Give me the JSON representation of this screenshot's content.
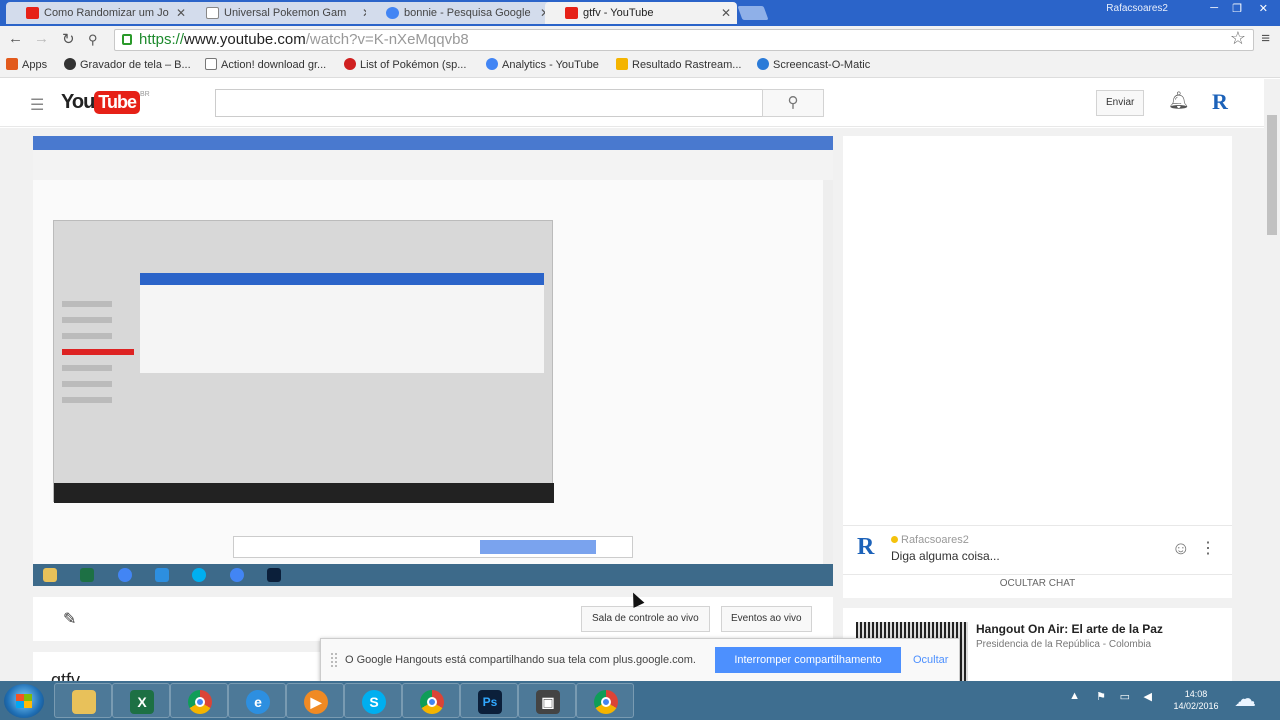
{
  "browser": {
    "tabs": [
      {
        "label": "Como Randomizar um Jo",
        "icon": "youtube-icon",
        "color": "#e62117"
      },
      {
        "label": "Universal Pokemon Gam",
        "icon": "page-icon",
        "color": "#ffffff"
      },
      {
        "label": "bonnie - Pesquisa Google",
        "icon": "google-icon",
        "color": "#4285f4"
      },
      {
        "label": "gtfv - YouTube",
        "icon": "youtube-icon",
        "color": "#e62117"
      }
    ],
    "window_user": "Rafacsoares2",
    "url": {
      "scheme": "https://",
      "host": "www.youtube.com",
      "path": "/watch?v=K-nXeMqqvb8"
    },
    "bookmarks": [
      {
        "label": "Apps",
        "icon": "apps-icon",
        "color": "#e25a1c"
      },
      {
        "label": "Gravador de tela – B...",
        "icon": "recorder-icon",
        "color": "#333333"
      },
      {
        "label": "Action! download gr...",
        "icon": "page-icon",
        "color": "#ffffff"
      },
      {
        "label": "List of Pokémon (sp...",
        "icon": "pokeball-icon",
        "color": "#d02020"
      },
      {
        "label": "Analytics - YouTube",
        "icon": "google-icon",
        "color": "#4285f4"
      },
      {
        "label": "Resultado Rastream...",
        "icon": "tracking-icon",
        "color": "#f4b400"
      },
      {
        "label": "Screencast-O-Matic",
        "icon": "screencast-icon",
        "color": "#2b7bd8"
      }
    ]
  },
  "youtube": {
    "logo_you": "You",
    "logo_tube": "Tube",
    "logo_region": "BR",
    "search_placeholder": "",
    "upload_label": "Enviar",
    "avatar_letter": "R",
    "video_title": "gtfv"
  },
  "chat": {
    "avatar_letter": "R",
    "username": "Rafacsoares2",
    "input_prompt": "Diga alguma coisa...",
    "hide_chat_label": "OCULTAR CHAT"
  },
  "controls": {
    "control_room_label": "Sala de controle ao vivo",
    "live_events_label": "Eventos ao vivo"
  },
  "related": {
    "title": "Hangout On Air: El arte de la Paz",
    "channel": "Presidencia de la República - Colombia"
  },
  "share_notice": {
    "message": "O Google Hangouts está compartilhando sua tela com plus.google.com.",
    "stop_label": "Interromper compartilhamento",
    "hide_label": "Ocultar"
  },
  "taskbar": {
    "apps": [
      {
        "name": "file-explorer",
        "label": "",
        "color": "#e8c15a"
      },
      {
        "name": "excel",
        "label": "X",
        "color": "#1d7044"
      },
      {
        "name": "chrome",
        "label": "",
        "color": "#4285f4"
      },
      {
        "name": "internet-explorer",
        "label": "e",
        "color": "#2d8fe0"
      },
      {
        "name": "media-player",
        "label": "▶",
        "color": "#f08a24"
      },
      {
        "name": "skype",
        "label": "S",
        "color": "#00aff0"
      },
      {
        "name": "chrome-2",
        "label": "",
        "color": "#4285f4"
      },
      {
        "name": "photoshop",
        "label": "Ps",
        "color": "#0b1f3a"
      },
      {
        "name": "recorder",
        "label": "▣",
        "color": "#444444"
      },
      {
        "name": "chrome-3",
        "label": "",
        "color": "#4285f4"
      }
    ],
    "time": "14:08",
    "date": "14/02/2016"
  }
}
